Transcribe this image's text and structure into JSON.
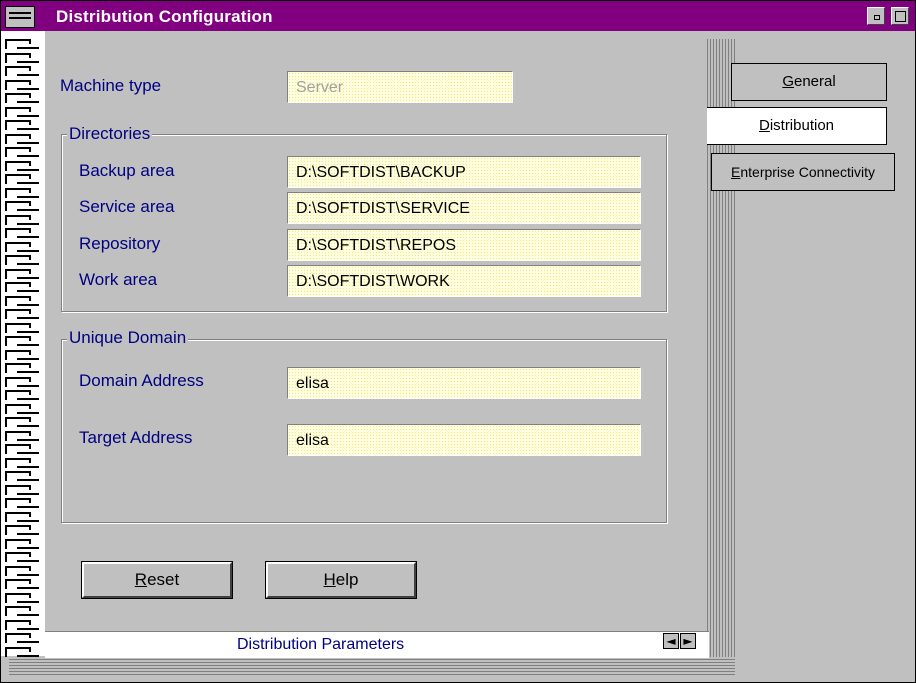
{
  "window": {
    "title": "Distribution Configuration"
  },
  "tabs": [
    {
      "label_key": "G",
      "label_rest": "eneral",
      "active": false
    },
    {
      "label_key": "D",
      "label_rest": "istribution",
      "active": true
    },
    {
      "label_key": "E",
      "label_rest": "nterprise Connectivity",
      "active": false
    }
  ],
  "machine": {
    "label": "Machine type",
    "value": "Server"
  },
  "directories": {
    "title": "Directories",
    "rows": [
      {
        "label": "Backup area",
        "value": "D:\\SOFTDIST\\BACKUP"
      },
      {
        "label": "Service area",
        "value": "D:\\SOFTDIST\\SERVICE"
      },
      {
        "label": "Repository",
        "value": "D:\\SOFTDIST\\REPOS"
      },
      {
        "label": "Work area",
        "value": "D:\\SOFTDIST\\WORK"
      }
    ]
  },
  "domain": {
    "title": "Unique Domain",
    "domain_label": "Domain Address",
    "domain_value": "elisa",
    "target_label": "Target Address",
    "target_value": "elisa"
  },
  "buttons": {
    "reset_key": "R",
    "reset_rest": "eset",
    "help_key": "H",
    "help_rest": "elp"
  },
  "status": {
    "page_title": "Distribution Parameters"
  },
  "icons": {
    "prev": "left-arrow-icon",
    "next": "right-arrow-icon"
  },
  "colors": {
    "titlebar": "#800080",
    "label_text": "#000080",
    "field_bg": "#ffffe0"
  }
}
